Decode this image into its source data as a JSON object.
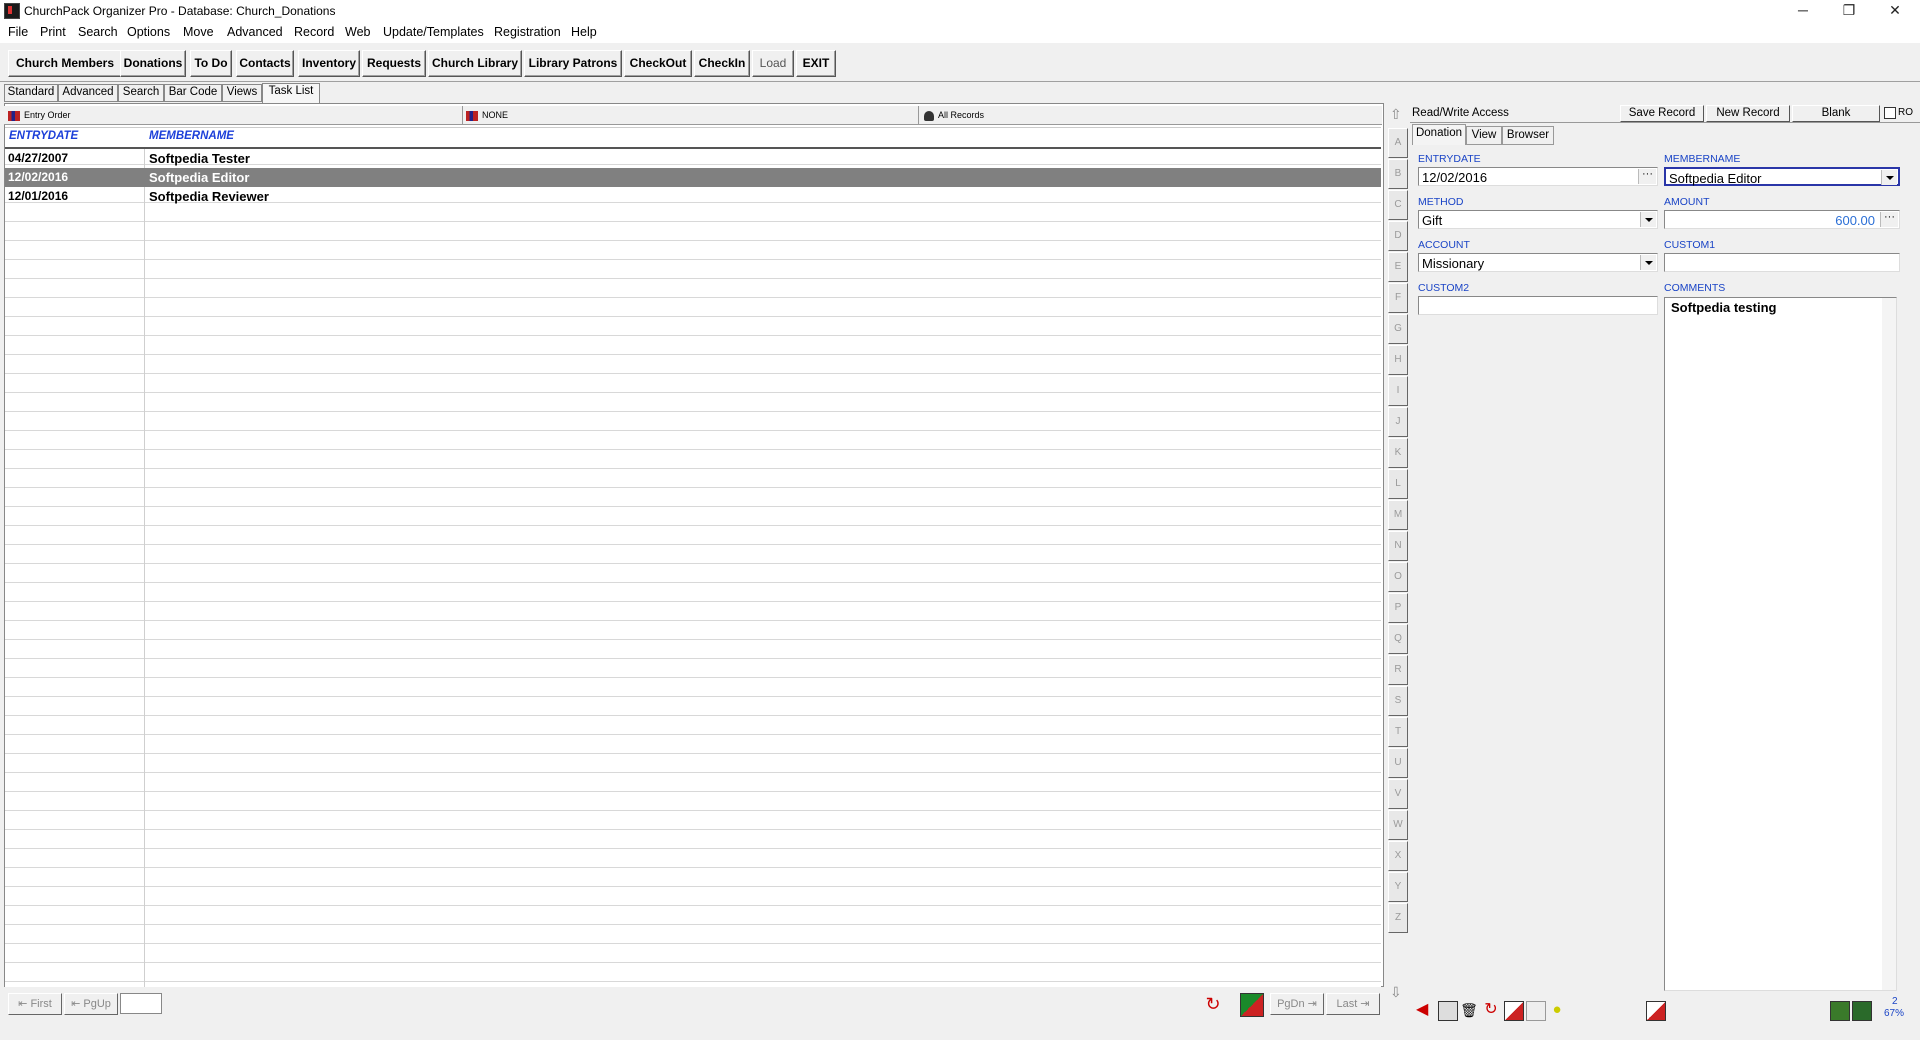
{
  "window": {
    "title": "ChurchPack Organizer Pro - Database: Church_Donations",
    "controls": [
      "─",
      "❐",
      "✕"
    ]
  },
  "menu": [
    "File",
    "Print",
    "Search",
    "Options",
    "Move",
    "Advanced",
    "Record",
    "Web",
    "Update/Templates",
    "Registration",
    "Help"
  ],
  "toolbar": [
    "Church Members",
    "Donations",
    "To Do",
    "Contacts",
    "Inventory",
    "Requests",
    "Church Library",
    "Library Patrons",
    "CheckOut",
    "CheckIn",
    "Load",
    "EXIT"
  ],
  "subtabs": [
    "Standard",
    "Advanced",
    "Search",
    "Bar Code",
    "Views",
    "Task List"
  ],
  "filters": {
    "order": "Entry Order",
    "filter": "NONE",
    "records": "All Records"
  },
  "grid": {
    "columns": [
      "ENTRYDATE",
      "MEMBERNAME"
    ],
    "rows": [
      [
        "04/27/2007",
        "Softpedia Tester"
      ],
      [
        "12/02/2016",
        "Softpedia Editor"
      ],
      [
        "12/01/2016",
        "Softpedia Reviewer"
      ]
    ],
    "selected_row": 1
  },
  "nav": {
    "first": "First",
    "pgup": "PgUp",
    "pgdn": "PgDn",
    "last": "Last"
  },
  "alphabet": [
    "A",
    "B",
    "C",
    "D",
    "E",
    "F",
    "G",
    "H",
    "I",
    "J",
    "K",
    "L",
    "M",
    "N",
    "O",
    "P",
    "Q",
    "R",
    "S",
    "T",
    "U",
    "V",
    "W",
    "X",
    "Y",
    "Z"
  ],
  "record": {
    "access": "Read/Write Access",
    "save": "Save Record",
    "new": "New Record",
    "blank": "Blank",
    "ro": "RO",
    "tabs": [
      "Donation",
      "View",
      "Browser"
    ],
    "fields": {
      "entrydate_label": "ENTRYDATE",
      "entrydate": "12/02/2016",
      "membername_label": "MEMBERNAME",
      "membername": "Softpedia Editor",
      "method_label": "METHOD",
      "method": "Gift",
      "amount_label": "AMOUNT",
      "amount": "600.00",
      "account_label": "ACCOUNT",
      "account": "Missionary",
      "custom1_label": "CUSTOM1",
      "custom1": "",
      "custom2_label": "CUSTOM2",
      "custom2": "",
      "comments_label": "COMMENTS",
      "comments": "Softpedia testing"
    }
  },
  "status": {
    "zoom": "67%",
    "count": "2"
  },
  "colors": {
    "accent": "#1a44c6",
    "selection": "#808080",
    "amount": "#2b6fd6"
  }
}
